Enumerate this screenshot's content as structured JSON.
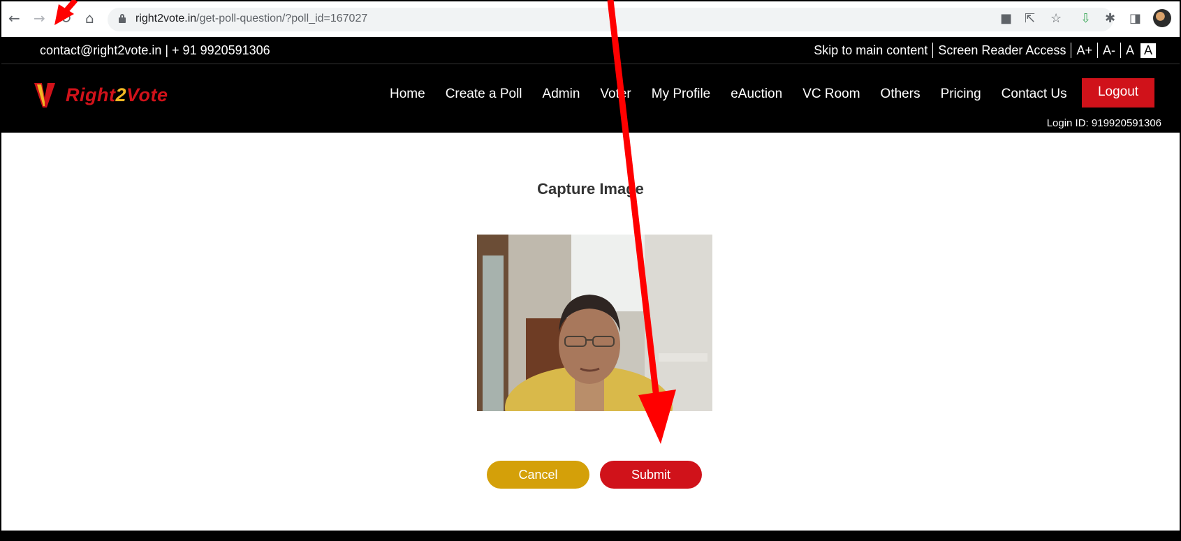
{
  "browser": {
    "url_host": "right2vote.in",
    "url_path": "/get-poll-question/?poll_id=167027",
    "back_icon": "arrow-left-icon",
    "forward_icon": "arrow-right-icon",
    "reload_icon": "reload-icon",
    "home_icon": "home-icon"
  },
  "topbar": {
    "contact": "contact@right2vote.in  |  + 91 9920591306",
    "skip": "Skip to main content",
    "screen_reader": "Screen Reader Access",
    "font_inc": "A+",
    "font_dec": "A-",
    "font_normal": "A",
    "font_contrast": "A"
  },
  "nav": {
    "logo_text_a": "Right",
    "logo_text_b": "2",
    "logo_text_c": "Vote",
    "items": [
      "Home",
      "Create a Poll",
      "Admin",
      "Voter",
      "My Profile",
      "eAuction",
      "VC Room",
      "Others",
      "Pricing",
      "Contact Us"
    ],
    "logout": "Logout",
    "login_id": "Login ID: 919920591306"
  },
  "content": {
    "title": "Capture Image",
    "cancel": "Cancel",
    "submit": "Submit"
  },
  "colors": {
    "brand_red": "#d0121a",
    "brand_gold": "#d4a009",
    "annotation_red": "#ff0000"
  }
}
